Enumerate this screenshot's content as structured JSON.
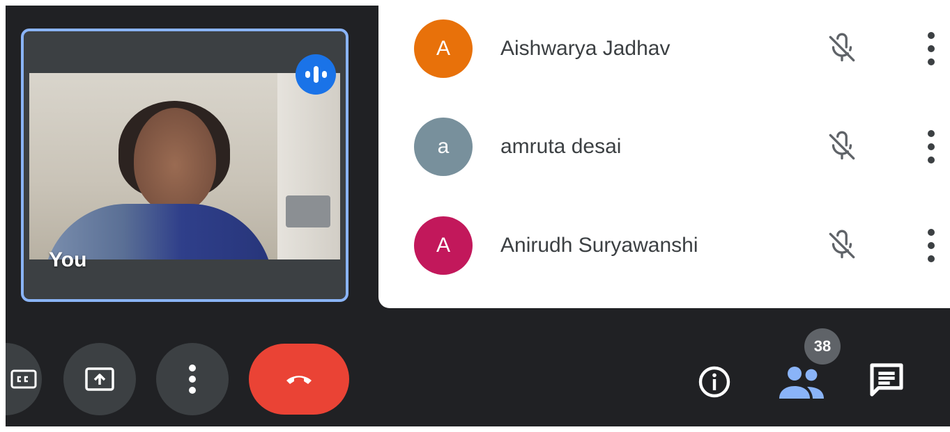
{
  "self_tile": {
    "label": "You",
    "speaking_icon": "audio-level-icon"
  },
  "participants": [
    {
      "initial": "A",
      "name": "Aishwarya Jadhav",
      "avatar_color": "#e8710a",
      "mic_icon": "mic-off-icon"
    },
    {
      "initial": "a",
      "name": "amruta desai",
      "avatar_color": "#78909c",
      "mic_icon": "mic-off-icon"
    },
    {
      "initial": "A",
      "name": "Anirudh Suryawanshi",
      "avatar_color": "#c2185b",
      "mic_icon": "mic-off-icon"
    }
  ],
  "controls": {
    "captions_icon": "closed-captions-icon",
    "present_icon": "present-screen-icon",
    "more_icon": "more-options-icon",
    "leave_icon": "end-call-icon"
  },
  "toolbar_right": {
    "info_icon": "info-icon",
    "people_icon": "people-icon",
    "people_count": "38",
    "chat_icon": "chat-icon"
  },
  "colors": {
    "background": "#202124",
    "accent": "#8ab4f8",
    "leave": "#ea4335",
    "speaking": "#1a73e8"
  }
}
